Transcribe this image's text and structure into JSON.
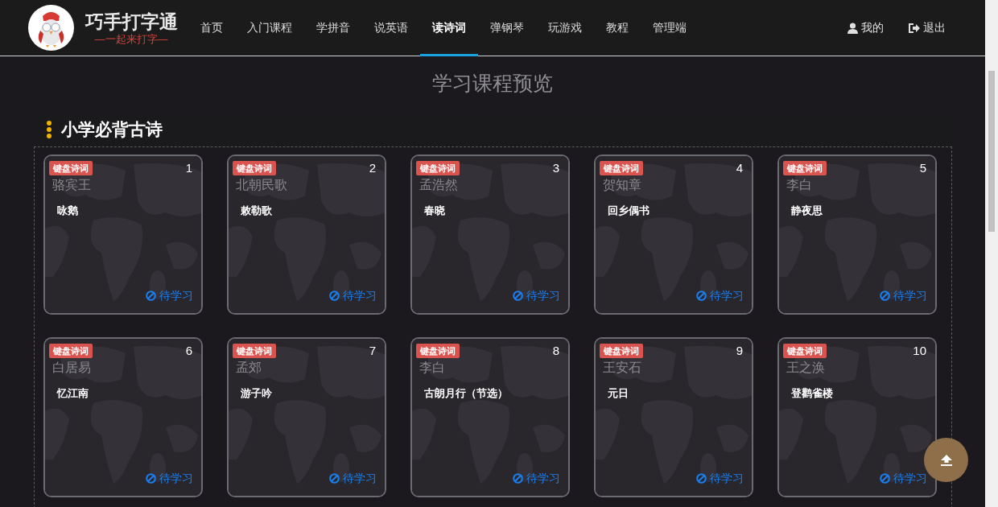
{
  "brand": {
    "title": "巧手打字通",
    "slogan": "—一起来打字—"
  },
  "nav": [
    {
      "label": "首页",
      "selected": false
    },
    {
      "label": "入门课程",
      "selected": false
    },
    {
      "label": "学拼音",
      "selected": false
    },
    {
      "label": "说英语",
      "selected": false
    },
    {
      "label": "读诗词",
      "selected": true
    },
    {
      "label": "弹钢琴",
      "selected": false
    },
    {
      "label": "玩游戏",
      "selected": false
    },
    {
      "label": "教程",
      "selected": false
    },
    {
      "label": "管理端",
      "selected": false
    }
  ],
  "user_menu": [
    {
      "kind": "profile",
      "label": "我的"
    },
    {
      "kind": "logout",
      "label": "退出"
    }
  ],
  "page_title": "学习课程预览",
  "section": {
    "title": "小学必背古诗",
    "cards": [
      {
        "tag": "键盘诗词",
        "number": "1",
        "author": "骆宾王",
        "title": "咏鹅",
        "status": "待学习"
      },
      {
        "tag": "键盘诗词",
        "number": "2",
        "author": "北朝民歌",
        "title": "敕勒歌",
        "status": "待学习"
      },
      {
        "tag": "键盘诗词",
        "number": "3",
        "author": "孟浩然",
        "title": "春晓",
        "status": "待学习"
      },
      {
        "tag": "键盘诗词",
        "number": "4",
        "author": "贺知章",
        "title": "回乡偶书",
        "status": "待学习"
      },
      {
        "tag": "键盘诗词",
        "number": "5",
        "author": "李白",
        "title": "静夜思",
        "status": "待学习"
      },
      {
        "tag": "键盘诗词",
        "number": "6",
        "author": "白居易",
        "title": "忆江南",
        "status": "待学习"
      },
      {
        "tag": "键盘诗词",
        "number": "7",
        "author": "孟郊",
        "title": "游子吟",
        "status": "待学习"
      },
      {
        "tag": "键盘诗词",
        "number": "8",
        "author": "李白",
        "title": "古朗月行（节选）",
        "status": "待学习"
      },
      {
        "tag": "键盘诗词",
        "number": "9",
        "author": "王安石",
        "title": "元日",
        "status": "待学习"
      },
      {
        "tag": "键盘诗词",
        "number": "10",
        "author": "王之涣",
        "title": "登鹳雀楼",
        "status": "待学习"
      }
    ]
  }
}
